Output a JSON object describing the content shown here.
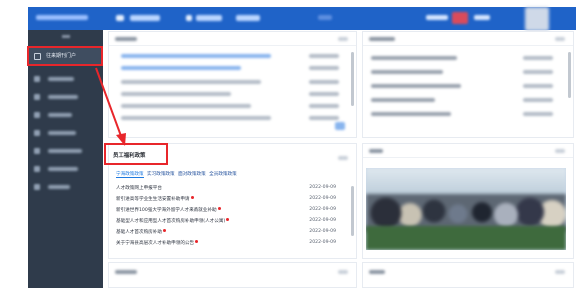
{
  "sidebar": {
    "active_item_label": "往来期刊门户"
  },
  "welfare_panel": {
    "title": "员工福利政策",
    "tabs": [
      "宁海政策政策",
      "实习政策政策",
      "面对政策政策",
      "全员政策政策"
    ],
    "items": [
      {
        "title": "人才政策网上申报平台",
        "date": "2022-09-09",
        "is_new": false
      },
      {
        "title": "新引进高等学业生生活安置补助申请",
        "date": "2022-09-09",
        "is_new": true
      },
      {
        "title": "新引进世界100强大学海外留学人才来甬就业补助",
        "date": "2022-09-09",
        "is_new": true
      },
      {
        "title": "基础型人才和应用型人才首次购房补助申领(人才公寓)",
        "date": "2022-09-09",
        "is_new": true
      },
      {
        "title": "基础人才首次购房补助",
        "date": "2022-09-09",
        "is_new": true
      },
      {
        "title": "关于宁海县高层次人才补助申领的公告",
        "date": "2022-09-09",
        "is_new": true
      }
    ]
  },
  "colors": {
    "header_blue": "#1f63c8",
    "sidebar_dark": "#2f3b4b",
    "annotation_red": "#e8262b",
    "link_blue": "#1f7ae0"
  }
}
